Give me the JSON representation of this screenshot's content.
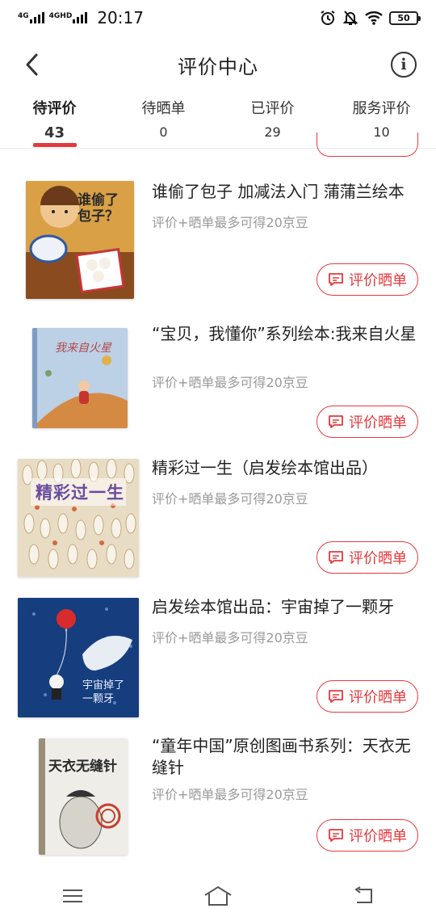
{
  "status": {
    "sim1": "4G",
    "sim2": "4GHD",
    "time": "20:17",
    "battery": "50",
    "icons": [
      "alarm-icon",
      "mute-icon",
      "wifi-icon",
      "battery-icon"
    ]
  },
  "header": {
    "title": "评价中心",
    "back_icon": "chevron-left-icon",
    "info_icon": "info-icon",
    "info_glyph": "i"
  },
  "tabs": [
    {
      "label": "待评价",
      "count": "43",
      "active": true
    },
    {
      "label": "待晒单",
      "count": "0",
      "active": false
    },
    {
      "label": "已评价",
      "count": "29",
      "active": false
    },
    {
      "label": "服务评价",
      "count": "10",
      "active": false
    }
  ],
  "items": [
    {
      "title": "谁偷了包子 加减法入门 蒲蒲兰绘本",
      "subtitle": "评价+晒单最多可得20京豆",
      "button": "评价晒单",
      "cover_text": "谁偷了包子？"
    },
    {
      "title": "“宝贝，我懂你”系列绘本:我来自火星",
      "subtitle": "评价+晒单最多可得20京豆",
      "button": "评价晒单",
      "cover_text": "我来自火星"
    },
    {
      "title": "精彩过一生（启发绘本馆出品）",
      "subtitle": "评价+晒单最多可得20京豆",
      "button": "评价晒单",
      "cover_text": "精彩过一生"
    },
    {
      "title": "启发绘本馆出品：宇宙掉了一颗牙",
      "subtitle": "评价+晒单最多可得20京豆",
      "button": "评价晒单",
      "cover_text": "宇宙掉了一颗牙"
    },
    {
      "title": "“童年中国”原创图画书系列：天衣无缝针",
      "subtitle": "评价+晒单最多可得20京豆",
      "button": "评价晒单",
      "cover_text": "天衣无缝针"
    }
  ],
  "colors": {
    "accent": "#e4393c",
    "subtitle": "#9a9a9a"
  },
  "navbar": [
    "menu-icon",
    "home-icon",
    "back-icon"
  ]
}
